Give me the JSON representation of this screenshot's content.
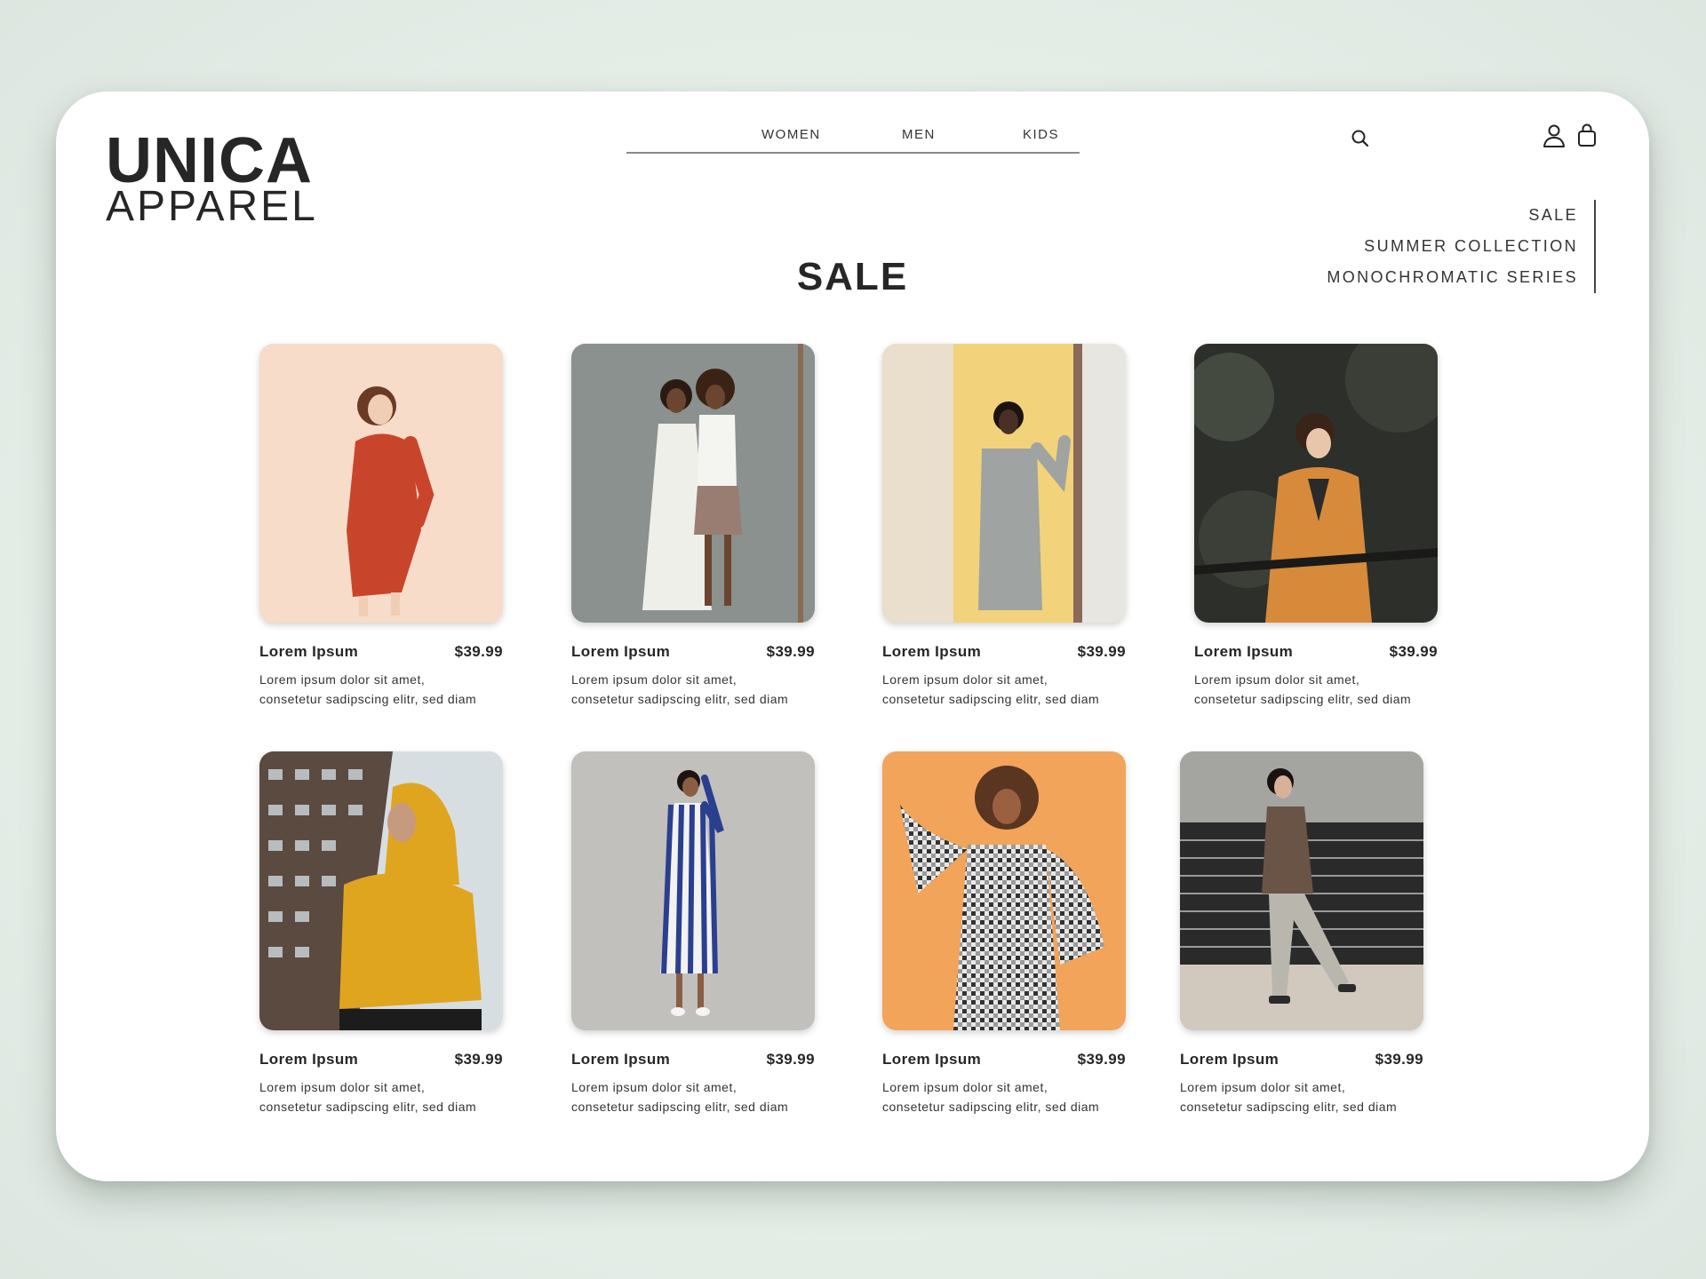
{
  "brand": {
    "line1": "UNICA",
    "line2": "APPAREL"
  },
  "nav": [
    {
      "label": "WOMEN"
    },
    {
      "label": "MEN"
    },
    {
      "label": "KIDS"
    }
  ],
  "icons": {
    "search": "search-icon",
    "account": "user-icon",
    "bag": "shopping-bag-icon"
  },
  "side_menu": [
    {
      "label": "SALE"
    },
    {
      "label": "SUMMER COLLECTION"
    },
    {
      "label": "MONOCHROMATIC SERIES"
    }
  ],
  "page_title": "SALE",
  "products": [
    {
      "name": "Lorem Ipsum",
      "price": "$39.99",
      "desc1": "Lorem ipsum dolor sit amet,",
      "desc2": "consetetur sadipscing elitr, sed diam",
      "photo": "woman in red floral wrap dress on peach background",
      "colors": {
        "bg": "#f4d6c0",
        "garment": "#c8452b"
      }
    },
    {
      "name": "Lorem Ipsum",
      "price": "$39.99",
      "desc1": "Lorem ipsum dolor sit amet,",
      "desc2": "consetetur sadipscing elitr, sed diam",
      "photo": "two women against weathered grey wall",
      "colors": {
        "bg": "#7f8583",
        "garment": "#efefe9"
      }
    },
    {
      "name": "Lorem Ipsum",
      "price": "$39.99",
      "desc1": "Lorem ipsum dolor sit amet,",
      "desc2": "consetetur sadipscing elitr, sed diam",
      "photo": "woman in grey shift dress by yellow wall",
      "colors": {
        "bg": "#f2d27a",
        "garment": "#9fa3a2"
      }
    },
    {
      "name": "Lorem Ipsum",
      "price": "$39.99",
      "desc1": "Lorem ipsum dolor sit amet,",
      "desc2": "consetetur sadipscing elitr, sed diam",
      "photo": "woman in orange plaid outfit, dark trees",
      "colors": {
        "bg": "#2c2f2a",
        "garment": "#d78a3a"
      }
    },
    {
      "name": "Lorem Ipsum",
      "price": "$39.99",
      "desc1": "Lorem ipsum dolor sit amet,",
      "desc2": "consetetur sadipscing elitr, sed diam",
      "photo": "man in yellow hoodie before tall building",
      "colors": {
        "bg": "#5b4a40",
        "garment": "#e0a51e"
      }
    },
    {
      "name": "Lorem Ipsum",
      "price": "$39.99",
      "desc1": "Lorem ipsum dolor sit amet,",
      "desc2": "consetetur sadipscing elitr, sed diam",
      "photo": "woman in blue striped dress by concrete wall",
      "colors": {
        "bg": "#b9b8b5",
        "garment": "#2b3f8f"
      }
    },
    {
      "name": "Lorem Ipsum",
      "price": "$39.99",
      "desc1": "Lorem ipsum dolor sit amet,",
      "desc2": "consetetur sadipscing elitr,  sed diam",
      "photo": "woman in gingham ruffle dress on orange",
      "colors": {
        "bg": "#f1a45a",
        "garment": "#4a4a4a"
      }
    },
    {
      "name": "Lorem Ipsum",
      "price": "$39.99",
      "desc1": "Lorem ipsum dolor sit amet,",
      "desc2": "consetetur sadipscing elitr, sed diam",
      "photo": "man in brown sweater walking by railing",
      "colors": {
        "bg": "#8e8e8a",
        "garment": "#6a5446"
      }
    }
  ]
}
